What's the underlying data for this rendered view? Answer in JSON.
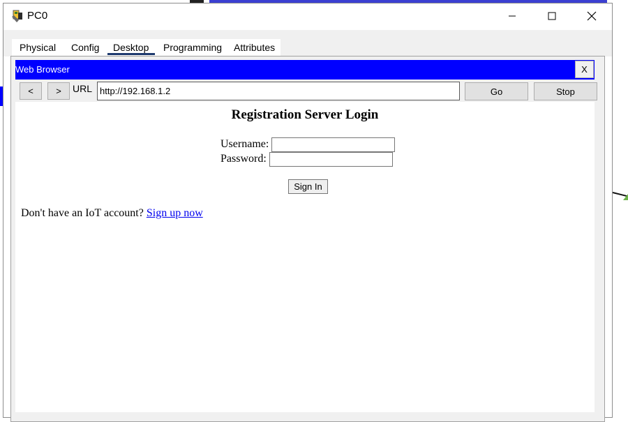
{
  "window": {
    "title": "PC0",
    "icon": "pc-icon",
    "controls": {
      "minimize": "minimize-icon",
      "maximize": "maximize-icon",
      "close": "close-icon"
    }
  },
  "tabs": [
    {
      "label": "Physical",
      "active": false
    },
    {
      "label": "Config",
      "active": false
    },
    {
      "label": "Desktop",
      "active": true
    },
    {
      "label": "Programming",
      "active": false
    },
    {
      "label": "Attributes",
      "active": false
    }
  ],
  "browser": {
    "title": "Web Browser",
    "close_label": "X",
    "back_label": "<",
    "forward_label": ">",
    "url_label": "URL",
    "url_value": "http://192.168.1.2",
    "go_label": "Go",
    "stop_label": "Stop"
  },
  "page": {
    "heading": "Registration Server Login",
    "username_label": "Username:",
    "password_label": "Password:",
    "username_value": "",
    "password_value": "",
    "signin_label": "Sign In",
    "signup_prompt": "Don't have an IoT account?",
    "signup_link": "Sign up now"
  },
  "colors": {
    "browser_titlebar": "#0000ff",
    "link": "#0000ee",
    "active_tab_underline": "#1e3a6e"
  }
}
